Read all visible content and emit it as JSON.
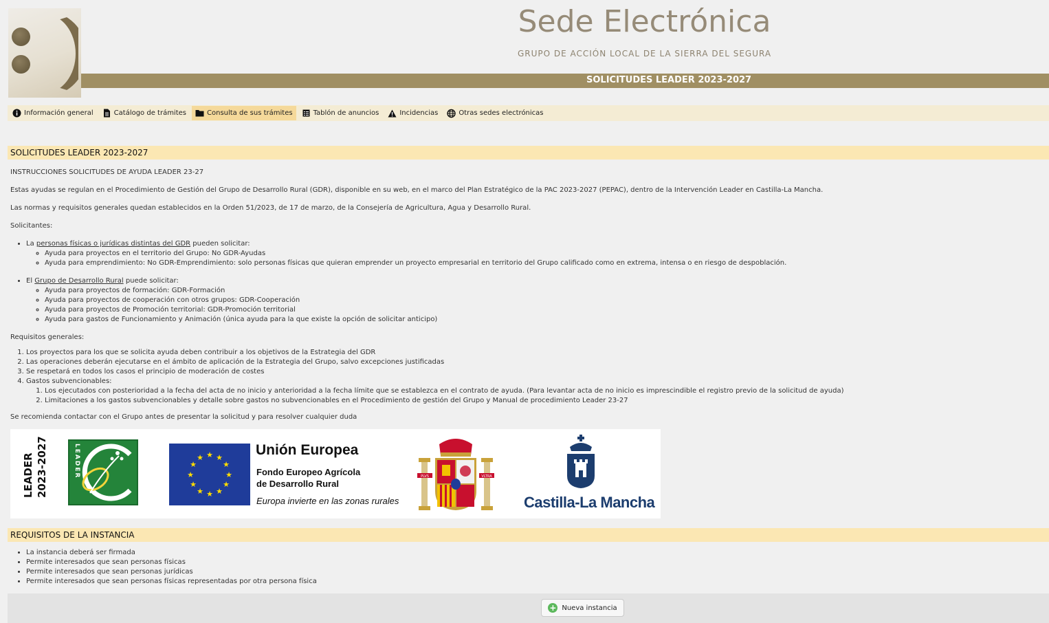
{
  "header": {
    "title": "Sede Electrónica",
    "subtitle": "GRUPO DE ACCIÓN LOCAL DE LA SIERRA DEL SEGURA",
    "banner": "SOLICITUDES LEADER 2023-2027"
  },
  "nav": [
    {
      "label": "Información general",
      "icon": "info-icon",
      "active": false
    },
    {
      "label": "Catálogo de trámites",
      "icon": "document-icon",
      "active": false
    },
    {
      "label": "Consulta de sus trámites",
      "icon": "folder-icon",
      "active": true
    },
    {
      "label": "Tablón de anuncios",
      "icon": "board-icon",
      "active": false
    },
    {
      "label": "Incidencias",
      "icon": "warning-icon",
      "active": false
    },
    {
      "label": "Otras sedes electrónicas",
      "icon": "globe-icon",
      "active": false
    }
  ],
  "main": {
    "section_title": "SOLICITUDES LEADER 2023-2027",
    "instructions_title": "INSTRUCCIONES SOLICITUDES DE AYUDA LEADER 23-27",
    "para1": "Estas ayudas se regulan en el Procedimiento de Gestión del Grupo de Desarrollo Rural (GDR), disponible en su web, en el marco del Plan Estratégico de la PAC 2023-2027 (PEPAC), dentro de la Intervención Leader en Castilla-La Mancha.",
    "para2": "Las normas y requisitos generales quedan establecidos en la Orden 51/2023, de 17 de marzo, de la Consejería de Agricultura, Agua y Desarrollo Rural.",
    "solicitantes_label": "Solicitantes:",
    "group1": {
      "prefix": " La ",
      "link": "personas físicas o jurídicas distintas del GDR",
      "suffix": " pueden solicitar:",
      "items": [
        "Ayuda para proyectos en el territorio del Grupo: No GDR-Ayudas",
        "Ayuda para emprendimiento: No GDR-Emprendimiento: solo personas físicas que quieran emprender un proyecto empresarial en territorio del Grupo calificado como en extrema, intensa o en riesgo de despoblación."
      ]
    },
    "group2": {
      "prefix": "El ",
      "link": "Grupo de Desarrollo Rural",
      "suffix": " puede solicitar:",
      "items": [
        "Ayuda para proyectos de formación: GDR-Formación",
        "Ayuda para proyectos de cooperación con otros grupos: GDR-Cooperación",
        "Ayuda para proyectos de Promoción territorial: GDR-Promoción territorial",
        "Ayuda para gastos de Funcionamiento y Animación (única ayuda para la que existe la opción de solicitar anticipo)"
      ]
    },
    "requisitos_label": "Requisitos generales:",
    "requisitos": [
      "Los proyectos para los que se solicita ayuda deben contribuir a los objetivos de la Estrategia del GDR",
      "Las operaciones deberán ejecutarse en el ámbito de aplicación de la Estrategia del Grupo, salvo excepciones justificadas",
      "Se respetará en todos los casos el principio de moderación de costes",
      "Gastos subvencionables:"
    ],
    "gastos": [
      "Los ejecutados con posterioridad a la fecha del acta de no inicio y anterioridad a la fecha límite que se establezca en el contrato de ayuda. (Para levantar acta de no inicio es imprescindible el registro previo de la solicitud de ayuda)",
      "Limitaciones a los gastos subvencionables y detalle sobre gastos no subvencionables en el Procedimiento de gestión del Grupo y Manual de procedimiento Leader 23-27"
    ],
    "recommendation": "Se recomienda contactar con el Grupo antes de presentar la solicitud y para resolver cualquier duda"
  },
  "logos": {
    "leader_line1": "LEADER",
    "leader_line2": "2023-2027",
    "leader_box_text": "LEADER",
    "eu_title": "Unión Europea",
    "eu_fund1": "Fondo Europeo Agrícola",
    "eu_fund2": "de Desarrollo Rural",
    "eu_motto": "Europa invierte en las zonas rurales",
    "coat_band_left": "PLVS",
    "coat_band_right": "VLTRA",
    "clm_name": "Castilla-La Mancha"
  },
  "instance": {
    "section_title": "REQUISITOS DE LA INSTANCIA",
    "items": [
      "La instancia deberá ser firmada",
      "Permite interesados que sean personas físicas",
      "Permite interesados que sean personas jurídicas",
      "Permite interesados que sean personas físicas representadas por otra persona física"
    ],
    "button_label": "Nueva instancia"
  },
  "colors": {
    "banner": "#a08f63",
    "nav_bg": "#f4ecd4",
    "nav_active": "#f5d99a",
    "section_bar": "#fbe7b3",
    "title": "#968b78"
  }
}
